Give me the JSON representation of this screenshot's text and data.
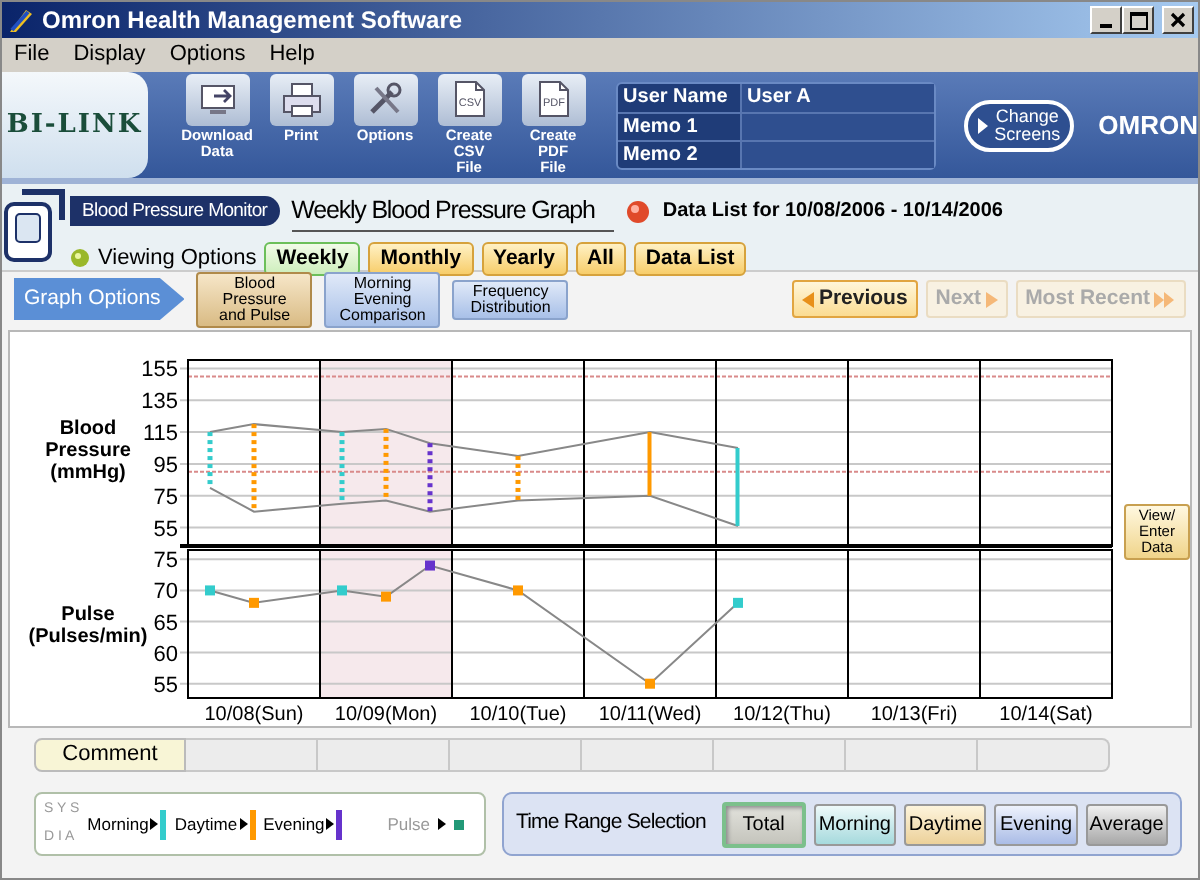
{
  "window": {
    "title": "Omron Health Management Software"
  },
  "menu": [
    "File",
    "Display",
    "Options",
    "Help"
  ],
  "header": {
    "logo": "BI-LINK",
    "toolbar": [
      {
        "label": "Download Data",
        "kind": "download"
      },
      {
        "label": "Print",
        "kind": "print"
      },
      {
        "label": "Options",
        "kind": "tools"
      },
      {
        "label": "Create CSV File",
        "kind": "file",
        "icon_text": "CSV"
      },
      {
        "label": "Create PDF File",
        "kind": "file",
        "icon_text": "PDF"
      }
    ],
    "user_fields": [
      {
        "label": "User Name",
        "value": "User A"
      },
      {
        "label": "Memo 1"
      },
      {
        "label": "Memo 2"
      }
    ],
    "change_button": "Change Screens",
    "brand": "OMRON"
  },
  "device": {
    "badge": "Blood Pressure Monitor",
    "title": "Weekly Blood Pressure Graph",
    "data_list": "Data List for 10/08/2006 - 10/14/2006"
  },
  "viewing_options": {
    "label": "Viewing Options",
    "tabs": [
      {
        "label": "Weekly",
        "selected": true
      },
      {
        "label": "Monthly",
        "selected": false
      },
      {
        "label": "Yearly",
        "selected": false
      },
      {
        "label": "All",
        "selected": false
      },
      {
        "label": "Data List",
        "selected": false
      }
    ]
  },
  "graph_options": {
    "label": "Graph Options",
    "tabs": [
      {
        "label": "Blood Pressure and Pulse",
        "selected": true
      },
      {
        "label": "Morning Evening Comparison",
        "selected": false
      },
      {
        "label": "Frequency Distribution",
        "selected": false
      }
    ]
  },
  "navigation": [
    {
      "label": "Previous",
      "kind": "prev",
      "disabled": false
    },
    {
      "label": "Next",
      "kind": "next",
      "disabled": true
    },
    {
      "label": "Most Recent",
      "kind": "last",
      "disabled": true
    }
  ],
  "graph": {
    "bp_title": [
      "Blood",
      "Pressure",
      "(mmHg)"
    ],
    "pulse_title": [
      "Pulse",
      "(Pulses/min)"
    ],
    "view_button": [
      "View/",
      "Enter Data"
    ],
    "day_columns": [
      {
        "selected": false
      },
      {
        "selected": true
      },
      {
        "selected": false
      },
      {
        "selected": false
      },
      {
        "selected": false
      },
      {
        "selected": false
      },
      {
        "selected": false
      }
    ],
    "readings": [
      {
        "dashed": true
      },
      {
        "dashed": true
      },
      {
        "dashed": true
      },
      {
        "dashed": true
      },
      {
        "dashed": true
      },
      {
        "dashed": true
      },
      {
        "dashed": false
      },
      {
        "dashed": false
      }
    ],
    "bp": {
      "chart_data": {
        "type": "line",
        "categories": [
          null,
          null,
          null,
          null,
          null,
          null,
          null,
          null,
          null,
          null,
          null,
          null,
          null,
          null,
          null,
          null,
          null,
          null,
          null,
          null,
          null
        ],
        "series": [
          {
            "color": "#888888",
            "values": [
              115,
              120,
              null,
              115,
              117,
              108,
              null,
              100,
              null,
              null,
              115,
              null,
              105,
              null,
              null,
              null,
              null,
              null,
              null,
              null,
              null
            ]
          },
          {
            "color": "#888888",
            "values": [
              80,
              65,
              null,
              70,
              72,
              65,
              null,
              72,
              null,
              null,
              75,
              null,
              56,
              null,
              null,
              null,
              null,
              null,
              null,
              null,
              null
            ]
          }
        ],
        "ylim": [
          43.4,
          160.3
        ],
        "yticks": [
          55,
          75,
          95,
          115,
          135,
          155
        ],
        "grid": true,
        "ref_lines": [
          {
            "axis": "y",
            "value": 150,
            "color": "#d98a8a"
          },
          {
            "axis": "y",
            "value": 90,
            "color": "#d98a8a"
          }
        ]
      }
    },
    "pulse": {
      "chart_data": {
        "type": "line",
        "categories": [
          null,
          "10/08(Sun)",
          null,
          null,
          "10/09(Mon)",
          null,
          null,
          "10/10(Tue)",
          null,
          null,
          "10/11(Wed)",
          null,
          null,
          "10/12(Thu)",
          null,
          null,
          "10/13(Fri)",
          null,
          null,
          "10/14(Sat)",
          null
        ],
        "series": [
          {
            "color": "#888888",
            "marker": "square",
            "values": [
              70,
              68,
              null,
              70,
              69,
              74,
              null,
              70,
              null,
              null,
              55,
              null,
              68,
              null,
              null,
              null,
              null,
              null,
              null,
              null,
              null
            ]
          }
        ],
        "ylim": [
          52.7,
          76.5
        ],
        "yticks": [
          55,
          60,
          65,
          70,
          75
        ],
        "grid": true
      }
    }
  },
  "comment": {
    "label": "Comment"
  },
  "legend": {
    "sys": "S Y S",
    "dia": "D I A",
    "items": [
      {
        "label": "Morning",
        "kind": "bar",
        "color": "#33cccc"
      },
      {
        "label": "Daytime",
        "kind": "bar",
        "color": "#ff9900"
      },
      {
        "label": "Evening",
        "kind": "bar",
        "color": "#6633cc"
      },
      {
        "label": "Pulse",
        "kind": "pulse",
        "color": "#229977"
      }
    ]
  },
  "time_range": {
    "label": "Time Range Selection",
    "buttons": [
      {
        "label": "Total",
        "kind": "total",
        "selected": true
      },
      {
        "label": "Morning",
        "kind": "morning",
        "selected": false
      },
      {
        "label": "Daytime",
        "kind": "daytime",
        "selected": false
      },
      {
        "label": "Evening",
        "kind": "evening",
        "selected": false
      },
      {
        "label": "Average",
        "kind": "average",
        "selected": false
      }
    ]
  }
}
